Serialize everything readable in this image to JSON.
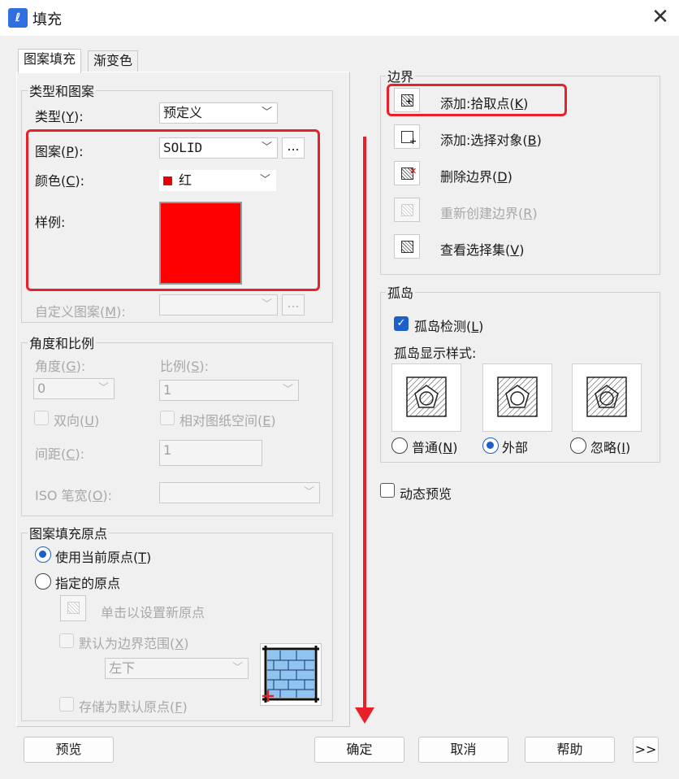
{
  "window": {
    "title": "填充",
    "close_glyph": "✕"
  },
  "tabs": [
    {
      "label": "图案填充",
      "active": true
    },
    {
      "label": "渐变色",
      "active": false
    }
  ],
  "type_pattern": {
    "group_title": "类型和图案",
    "type_label": "类型(",
    "type_key": "Y",
    "type_tail": "):",
    "type_value": "预定义",
    "pattern_label": "图案(",
    "pattern_key": "P",
    "pattern_tail": "):",
    "pattern_value": "SOLID",
    "pattern_browse": "...",
    "color_label": "颜色(",
    "color_key": "C",
    "color_tail": "):",
    "color_value": "红",
    "color_hex": "#e00000",
    "sample_label": "样例:",
    "custom_label": "自定义图案(",
    "custom_key": "M",
    "custom_tail": "):",
    "custom_browse": "..."
  },
  "angle_scale": {
    "group_title": "角度和比例",
    "angle_label": "角度(",
    "angle_key": "G",
    "angle_tail": "):",
    "angle_value": "0",
    "scale_label": "比例(",
    "scale_key": "S",
    "scale_tail": "):",
    "scale_value": "1",
    "double_label": "双向(",
    "double_key": "U",
    "double_tail": ")",
    "relative_label": "相对图纸空间(",
    "relative_key": "E",
    "relative_tail": ")",
    "spacing_label": "间距(",
    "spacing_key": "C",
    "spacing_tail": "):",
    "spacing_value": "1",
    "iso_label": "ISO 笔宽(",
    "iso_key": "O",
    "iso_tail": "):"
  },
  "origin": {
    "group_title": "图案填充原点",
    "use_current_label": "使用当前原点(",
    "use_current_key": "T",
    "use_current_tail": ")",
    "use_current_selected": true,
    "specified_label": "指定的原点",
    "specified_selected": false,
    "click_set_label": "单击以设置新原点",
    "default_extent_label": "默认为边界范围(",
    "default_extent_key": "X",
    "default_extent_tail": ")",
    "position_value": "左下",
    "store_default_label": "存储为默认原点(",
    "store_default_key": "F",
    "store_default_tail": ")"
  },
  "boundary": {
    "group_title": "边界",
    "buttons": [
      {
        "label": "添加:拾取点(",
        "key": "K",
        "tail": ")",
        "enabled": true
      },
      {
        "label": "添加:选择对象(",
        "key": "B",
        "tail": ")",
        "enabled": true
      },
      {
        "label": "删除边界(",
        "key": "D",
        "tail": ")",
        "enabled": true
      },
      {
        "label": "重新创建边界(",
        "key": "R",
        "tail": ")",
        "enabled": false
      },
      {
        "label": "查看选择集(",
        "key": "V",
        "tail": ")",
        "enabled": true
      }
    ]
  },
  "islands": {
    "group_title": "孤岛",
    "detect_label": "孤岛检测(",
    "detect_key": "L",
    "detect_tail": ")",
    "detect_checked": true,
    "style_label": "孤岛显示样式:",
    "styles": [
      {
        "label": "普通(",
        "key": "N",
        "tail": ")",
        "selected": false
      },
      {
        "label": "外部",
        "key": "",
        "tail": "",
        "selected": true
      },
      {
        "label": "忽略(",
        "key": "I",
        "tail": ")",
        "selected": false
      }
    ]
  },
  "preview_dynamic": {
    "label": "动态预览",
    "checked": false
  },
  "footer": {
    "preview": "预览",
    "ok": "确定",
    "cancel": "取消",
    "help": "帮助",
    "more": ">>"
  },
  "annotation_color": "#e8202a"
}
